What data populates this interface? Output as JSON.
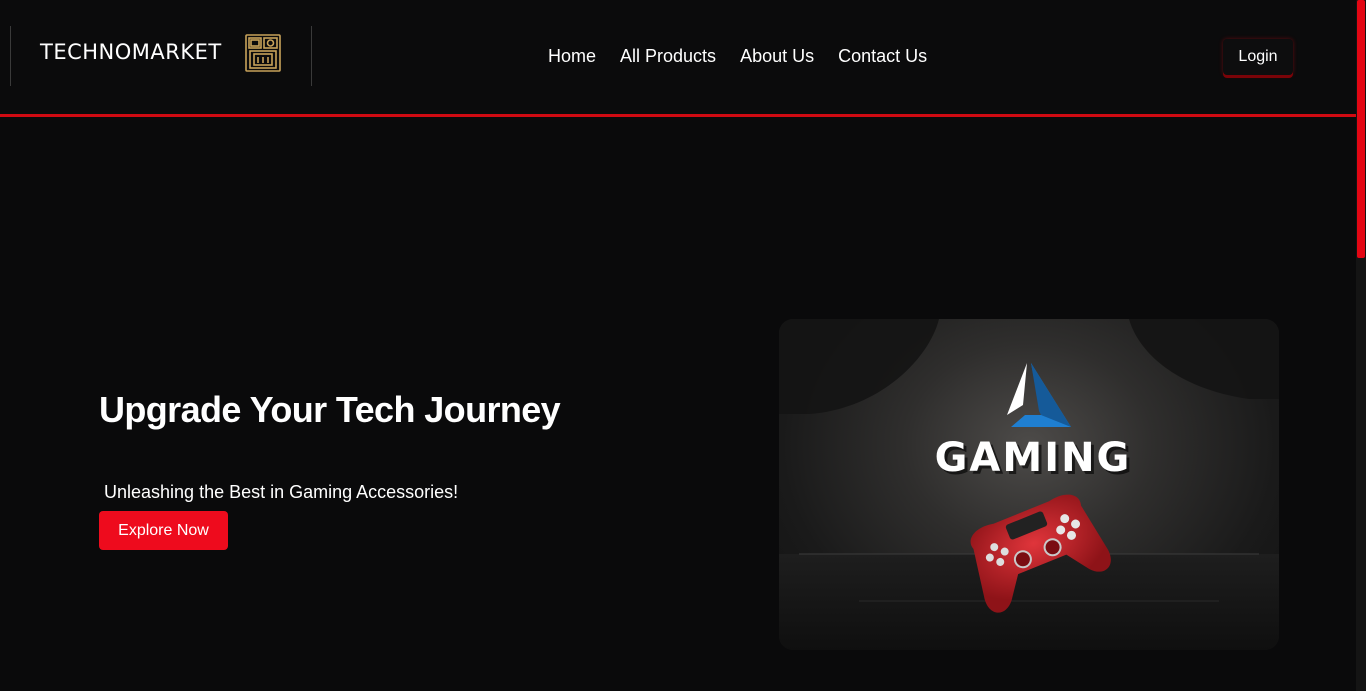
{
  "header": {
    "logo_text": "TECHNOMARKET",
    "logo_icon": "retro-computer-icon",
    "nav": [
      {
        "label": "Home"
      },
      {
        "label": "All Products"
      },
      {
        "label": "About Us"
      },
      {
        "label": "Contact Us"
      }
    ],
    "login_label": "Login"
  },
  "hero": {
    "title": "Upgrade Your Tech Journey",
    "subtitle": "Unleashing the Best in Gaming Accessories!",
    "cta_label": "Explore Now",
    "image": {
      "word": "GAMING",
      "depicts": [
        "gaming-logo-icon",
        "gamepad-icon"
      ]
    }
  },
  "colors": {
    "background": "#0a0a0b",
    "accent": "#ee0b1d",
    "divider": "#d00a12",
    "logo_gold": "#c8a25a",
    "gaming_blue": "#1f7fd1",
    "controller_red": "#c41e25"
  }
}
